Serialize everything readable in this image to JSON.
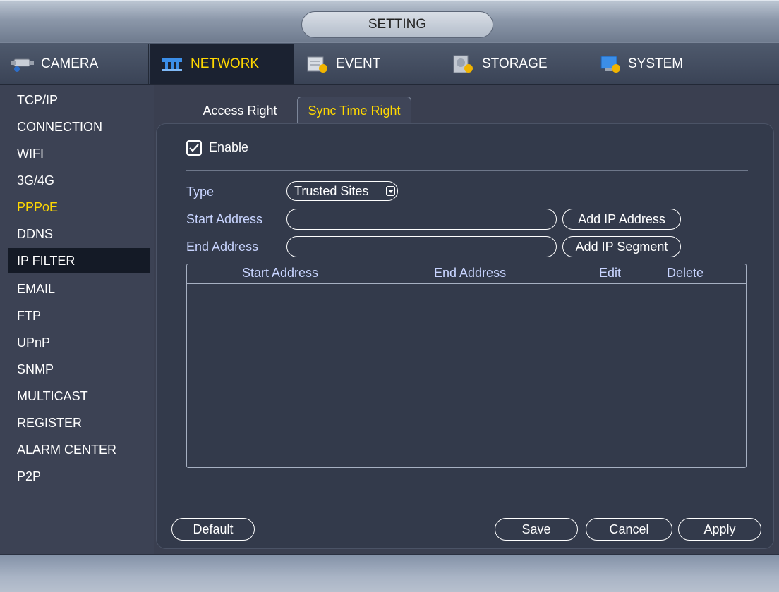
{
  "window": {
    "title": "SETTING"
  },
  "tabs": [
    {
      "label": "CAMERA",
      "icon": "camera-icon"
    },
    {
      "label": "NETWORK",
      "icon": "network-icon",
      "active": true
    },
    {
      "label": "EVENT",
      "icon": "event-icon"
    },
    {
      "label": "STORAGE",
      "icon": "storage-icon"
    },
    {
      "label": "SYSTEM",
      "icon": "system-icon"
    }
  ],
  "sidebar": {
    "items": [
      {
        "label": "TCP/IP"
      },
      {
        "label": "CONNECTION"
      },
      {
        "label": "WIFI"
      },
      {
        "label": "3G/4G"
      },
      {
        "label": "PPPoE"
      },
      {
        "label": "DDNS"
      },
      {
        "label": "IP FILTER",
        "selected": true
      },
      {
        "label": "EMAIL"
      },
      {
        "label": "FTP"
      },
      {
        "label": "UPnP"
      },
      {
        "label": "SNMP"
      },
      {
        "label": "MULTICAST"
      },
      {
        "label": "REGISTER"
      },
      {
        "label": "ALARM CENTER"
      },
      {
        "label": "P2P"
      }
    ]
  },
  "subtabs": [
    {
      "label": "Access Right"
    },
    {
      "label": "Sync Time Right",
      "active": true
    }
  ],
  "form": {
    "enable_label": "Enable",
    "enable_checked": true,
    "type_label": "Type",
    "type_value": "Trusted Sites",
    "start_label": "Start Address",
    "start_value": "",
    "end_label": "End Address",
    "end_value": "",
    "add_ip_address": "Add IP Address",
    "add_ip_segment": "Add IP Segment"
  },
  "table": {
    "columns": [
      "Start Address",
      "End Address",
      "Edit",
      "Delete"
    ],
    "rows": []
  },
  "buttons": {
    "default": "Default",
    "save": "Save",
    "cancel": "Cancel",
    "apply": "Apply"
  },
  "colors": {
    "accent": "#ffd800",
    "label": "#c8d4ff",
    "selected_bg": "#141a26"
  }
}
